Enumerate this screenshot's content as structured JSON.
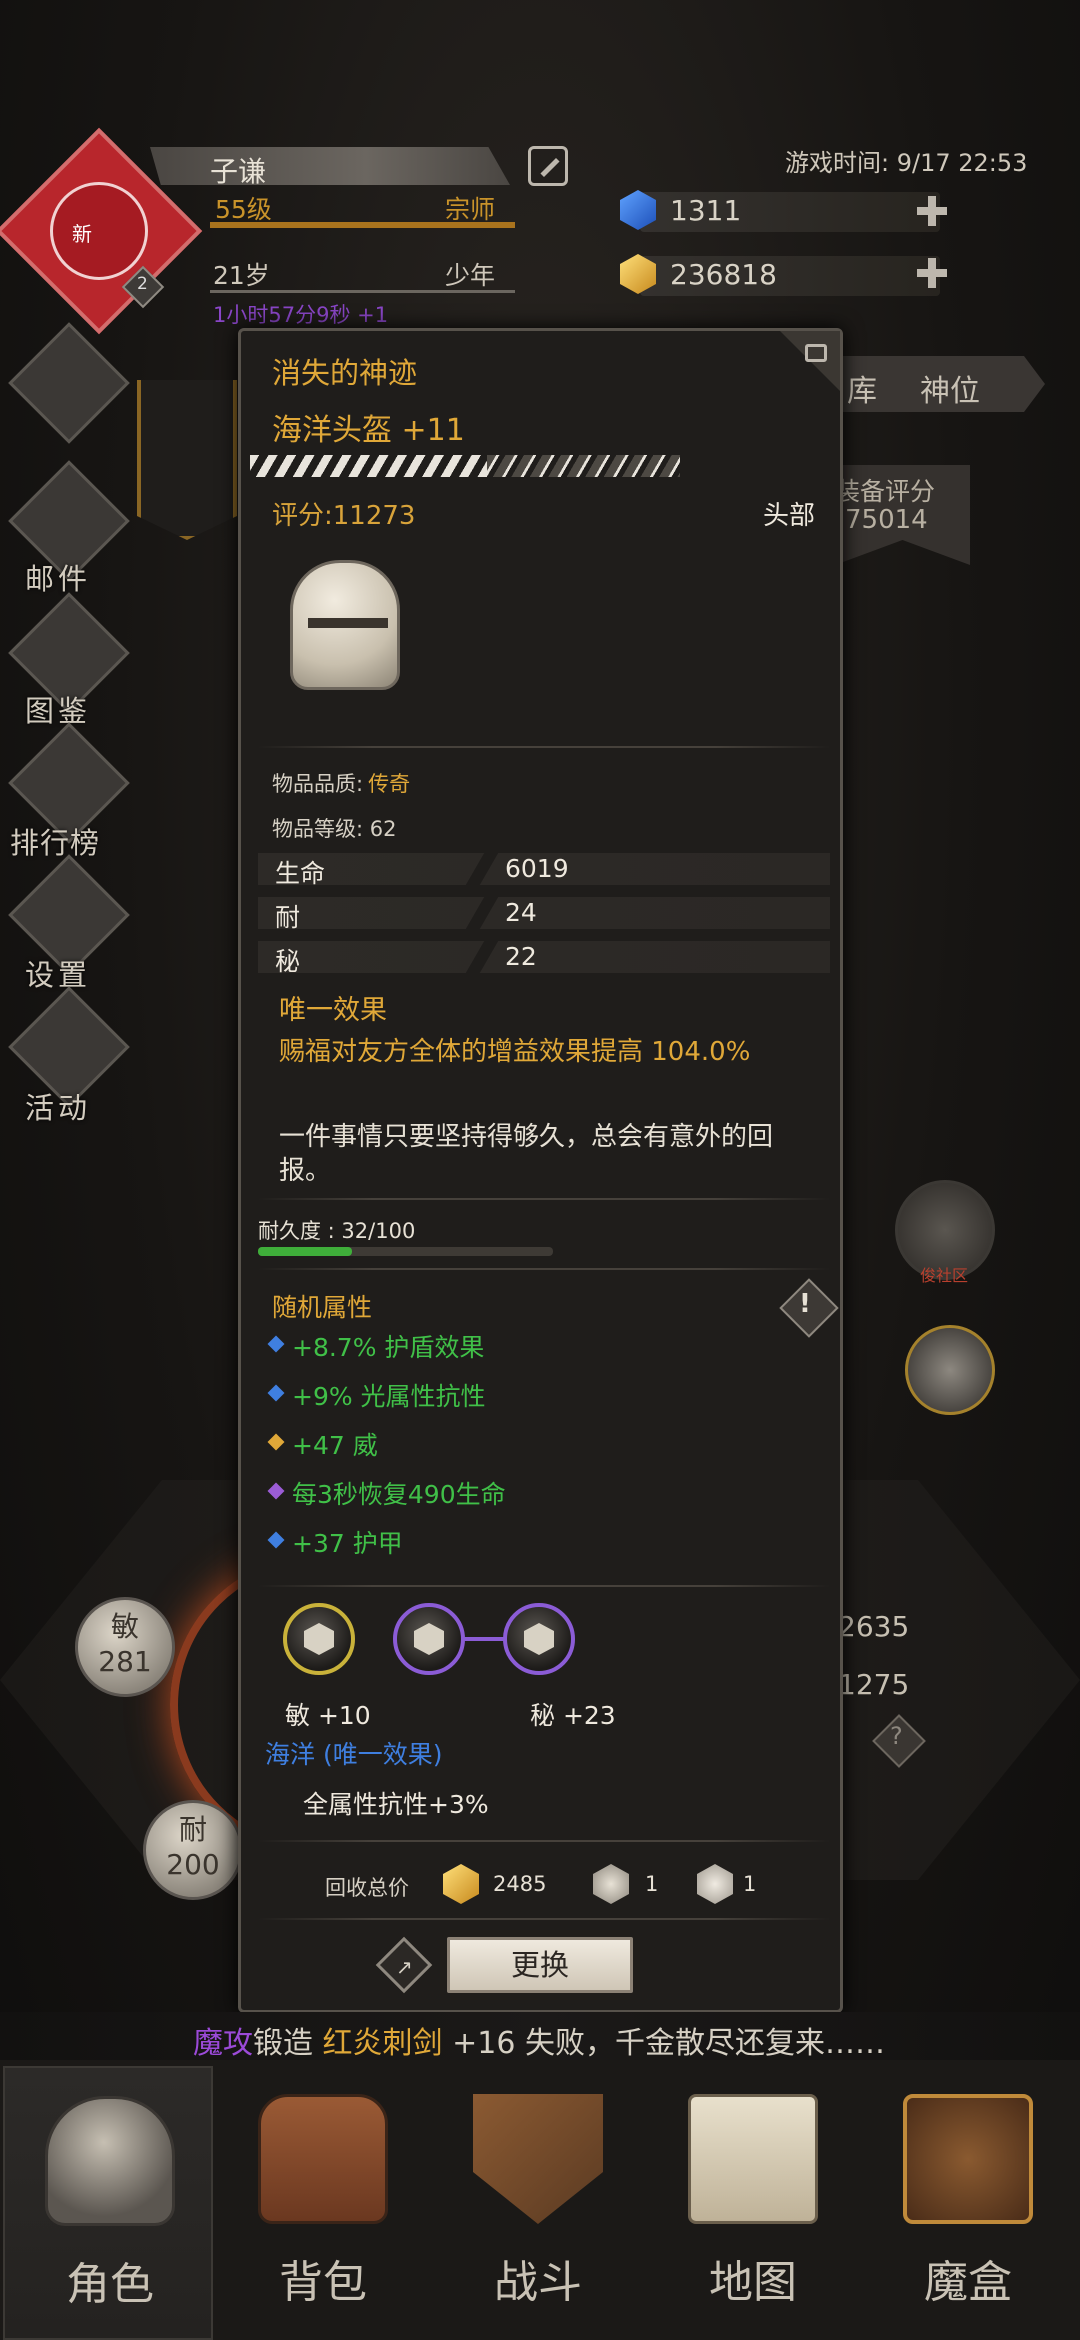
{
  "header": {
    "player_name": "子谦",
    "level": "55级",
    "rank": "宗师",
    "age": "21岁",
    "age_stage": "少年",
    "timer": "1小时57分9秒 +1",
    "avatar_text": "新",
    "avatar_badge": "2",
    "game_time": "游戏时间: 9/17 22:53",
    "gems": "1311",
    "gold": "236818"
  },
  "side_menu": [
    {
      "label": "邮件",
      "icon": "mail-icon"
    },
    {
      "label": "图鉴",
      "icon": "book-icon"
    },
    {
      "label": "排行榜",
      "icon": "ranking-icon"
    },
    {
      "label": "设置",
      "icon": "gear-icon"
    },
    {
      "label": "活动",
      "icon": "event-icon"
    }
  ],
  "background_panel": {
    "tab_storage": "库",
    "tab_divine": "神位",
    "equip_score_label": "装备评分",
    "equip_score_value": "75014",
    "stat_right_1": "2635",
    "stat_right_2": "1275",
    "circle_agi_label": "敏",
    "circle_agi_value": "281",
    "circle_end_label": "耐",
    "circle_end_value": "200",
    "guild_label": "俊社区"
  },
  "item": {
    "set_name": "消失的神迹",
    "name": "海洋头盔 +11",
    "enhance_level": 11,
    "enhance_max": 20,
    "score": "评分:11273",
    "slot": "头部",
    "quality_label": "物品品质:",
    "quality_value": "传奇",
    "item_level": "物品等级: 62",
    "stats": [
      {
        "key": "生命",
        "value": "6019"
      },
      {
        "key": "耐",
        "value": "24"
      },
      {
        "key": "秘",
        "value": "22"
      }
    ],
    "unique_heading": "唯一效果",
    "unique_text": "赐福对友方全体的增益效果提高 104.0%",
    "flavor": "一件事情只要坚持得够久，总会有意外的回报。",
    "durability_label": "耐久度 : 32/100",
    "durability_fraction": 0.32,
    "random_heading": "随机属性",
    "random_attrs": [
      {
        "text": "+8.7% 护盾效果",
        "dot": "#3f7fe0"
      },
      {
        "text": "+9% 光属性抗性",
        "dot": "#3f7fe0"
      },
      {
        "text": "+47 威",
        "dot": "#e0a838"
      },
      {
        "text": "每3秒恢复490生命",
        "dot": "#9b5cd6"
      },
      {
        "text": "+37 护甲",
        "dot": "#3f7fe0"
      }
    ],
    "sockets": [
      {
        "label": "敏 +10",
        "ring": "#c9b23a"
      },
      {
        "label": "",
        "ring": "#8b5cd6"
      },
      {
        "label": "秘 +23",
        "ring": "#8b5cd6"
      }
    ],
    "set_bonus_heading": "海洋 (唯一效果)",
    "set_bonus": "全属性抗性+3%",
    "recycle_label": "回收总价",
    "recycle_gold": "2485",
    "recycle_mat1": "1",
    "recycle_mat2": "1",
    "replace_button": "更换"
  },
  "ticker": {
    "player": "魔攻",
    "verb": "锻造",
    "item": "红炎刺剑",
    "rest": "+16 失败，千金散尽还复来……"
  },
  "nav": [
    {
      "label": "角色",
      "icon": "helmet-icon"
    },
    {
      "label": "背包",
      "icon": "backpack-icon"
    },
    {
      "label": "战斗",
      "icon": "sword-shield-icon"
    },
    {
      "label": "地图",
      "icon": "scroll-map-icon"
    },
    {
      "label": "魔盒",
      "icon": "magic-box-icon"
    }
  ],
  "colors": {
    "gold": "#e0a838",
    "green": "#40c048",
    "blue": "#3f7fe0",
    "purple": "#8a46c8"
  }
}
